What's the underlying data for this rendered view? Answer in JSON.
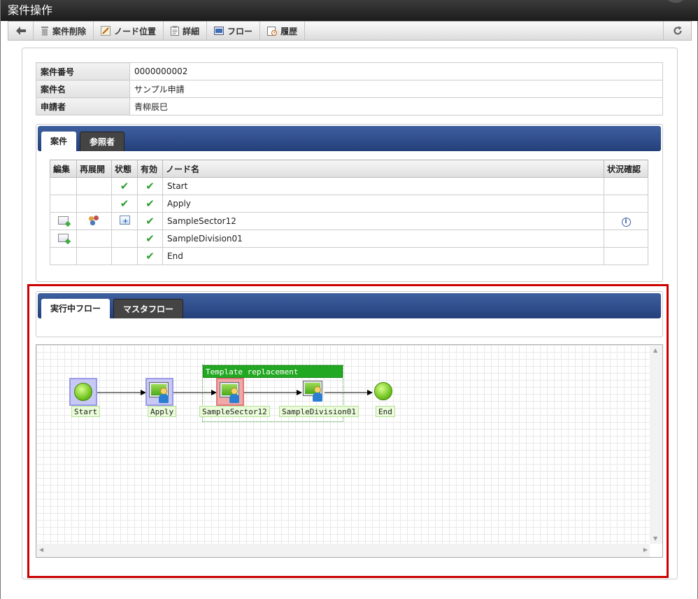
{
  "window": {
    "title": "案件操作"
  },
  "toolbar": {
    "items": [
      {
        "label": "案件削除",
        "icon": "trash-icon"
      },
      {
        "label": "ノード位置",
        "icon": "node-position-icon"
      },
      {
        "label": "詳細",
        "icon": "clipboard-icon"
      },
      {
        "label": "フロー",
        "icon": "flow-icon"
      },
      {
        "label": "履歴",
        "icon": "history-icon"
      }
    ]
  },
  "case_info": {
    "rows": [
      {
        "key": "案件番号",
        "value": "0000000002"
      },
      {
        "key": "案件名",
        "value": "サンプル申請"
      },
      {
        "key": "申請者",
        "value": "青柳辰巳"
      }
    ]
  },
  "case_tabs": {
    "active": "案件",
    "inactive": "参照者"
  },
  "node_table": {
    "headers": [
      "編集",
      "再展開",
      "状態",
      "有効",
      "ノード名",
      "状況確認"
    ],
    "rows": [
      {
        "edit": false,
        "redeploy": false,
        "state": "check",
        "valid": true,
        "name": "Start",
        "status": false
      },
      {
        "edit": false,
        "redeploy": false,
        "state": "check",
        "valid": true,
        "name": "Apply",
        "status": false
      },
      {
        "edit": true,
        "redeploy": true,
        "state": "running",
        "valid": true,
        "name": "SampleSector12",
        "status": true
      },
      {
        "edit": true,
        "redeploy": false,
        "state": "none",
        "valid": true,
        "name": "SampleDivision01",
        "status": false
      },
      {
        "edit": false,
        "redeploy": false,
        "state": "none",
        "valid": true,
        "name": "End",
        "status": false
      }
    ]
  },
  "flow_tabs": {
    "active": "実行中フロー",
    "inactive": "マスタフロー"
  },
  "flow": {
    "template_title": "Template replacement",
    "nodes": [
      "Start",
      "Apply",
      "SampleSector12",
      "SampleDivision01",
      "End"
    ]
  },
  "colors": {
    "highlight_border": "#cc0000",
    "tabbar": "#2c4a88",
    "check": "#2e9e2e"
  }
}
